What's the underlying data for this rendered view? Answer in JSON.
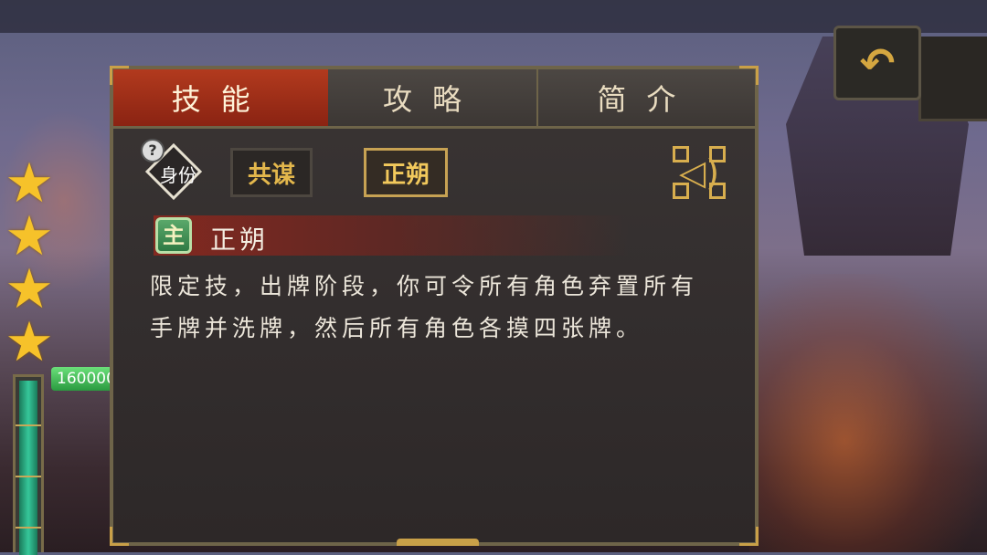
{
  "tabs": [
    {
      "label": "技能",
      "active": true
    },
    {
      "label": "攻略",
      "active": false
    },
    {
      "label": "简介",
      "active": false
    }
  ],
  "identity": {
    "label": "身份",
    "help": "?"
  },
  "skill_buttons": [
    {
      "label": "共谋",
      "selected": false
    },
    {
      "label": "正朔",
      "selected": true
    }
  ],
  "skill": {
    "badge": "主",
    "name": "正朔",
    "description_lines": [
      "限定技，出牌阶段，你可令所有角色弃置所有",
      "手牌并洗牌，然后所有角色各摸四张牌。"
    ]
  },
  "side": {
    "stars": 4,
    "exp_value": "160000"
  },
  "icons": {
    "back": "back-arrow-icon",
    "sound": "speaker-icon",
    "star": "star-icon"
  },
  "colors": {
    "active_tab": "#b23a1e",
    "gold_accent": "#d8ae4e",
    "exp_green": "#36c79a"
  }
}
